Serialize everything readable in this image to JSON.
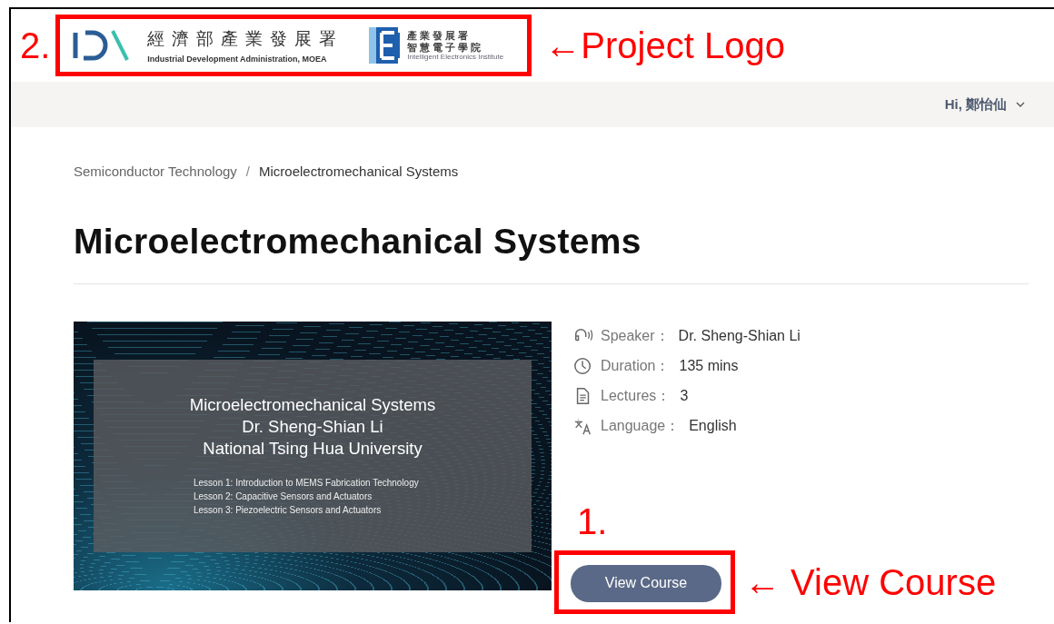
{
  "annotations": {
    "logo_number": "2.",
    "logo_label": "←Project Logo",
    "button_number": "1.",
    "button_label": "← View Course"
  },
  "logo": {
    "agency_name": "經濟部產業發展署",
    "agency_subtitle": "Industrial Development Administration, MOEA",
    "institute_line1": "產業發展署",
    "institute_line2": "智慧電子學院",
    "institute_subtitle": "Intelligent Electronics Institute"
  },
  "user_menu": {
    "greeting": "Hi, 鄭怡仙"
  },
  "breadcrumb": {
    "items": [
      "Semiconductor Technology",
      "Microelectromechanical Systems"
    ],
    "separator": "/"
  },
  "title": "Microelectromechanical Systems",
  "cover": {
    "title_lines": [
      "Microelectromechanical Systems",
      "Dr. Sheng-Shian Li",
      "National Tsing Hua University"
    ],
    "lessons": [
      "Lesson 1: Introduction to MEMS Fabrication Technology",
      "Lesson 2: Capacitive Sensors and Actuators",
      "Lesson 3: Piezoelectric Sensors and Actuators"
    ]
  },
  "details": [
    {
      "kind": "speaker",
      "label": "Speaker：",
      "value": "Dr. Sheng-Shian Li"
    },
    {
      "kind": "duration",
      "label": "Duration：",
      "value": "135 mins"
    },
    {
      "kind": "lectures",
      "label": "Lectures：",
      "value": "3"
    },
    {
      "kind": "language",
      "label": "Language：",
      "value": "English"
    }
  ],
  "view_button": "View Course"
}
